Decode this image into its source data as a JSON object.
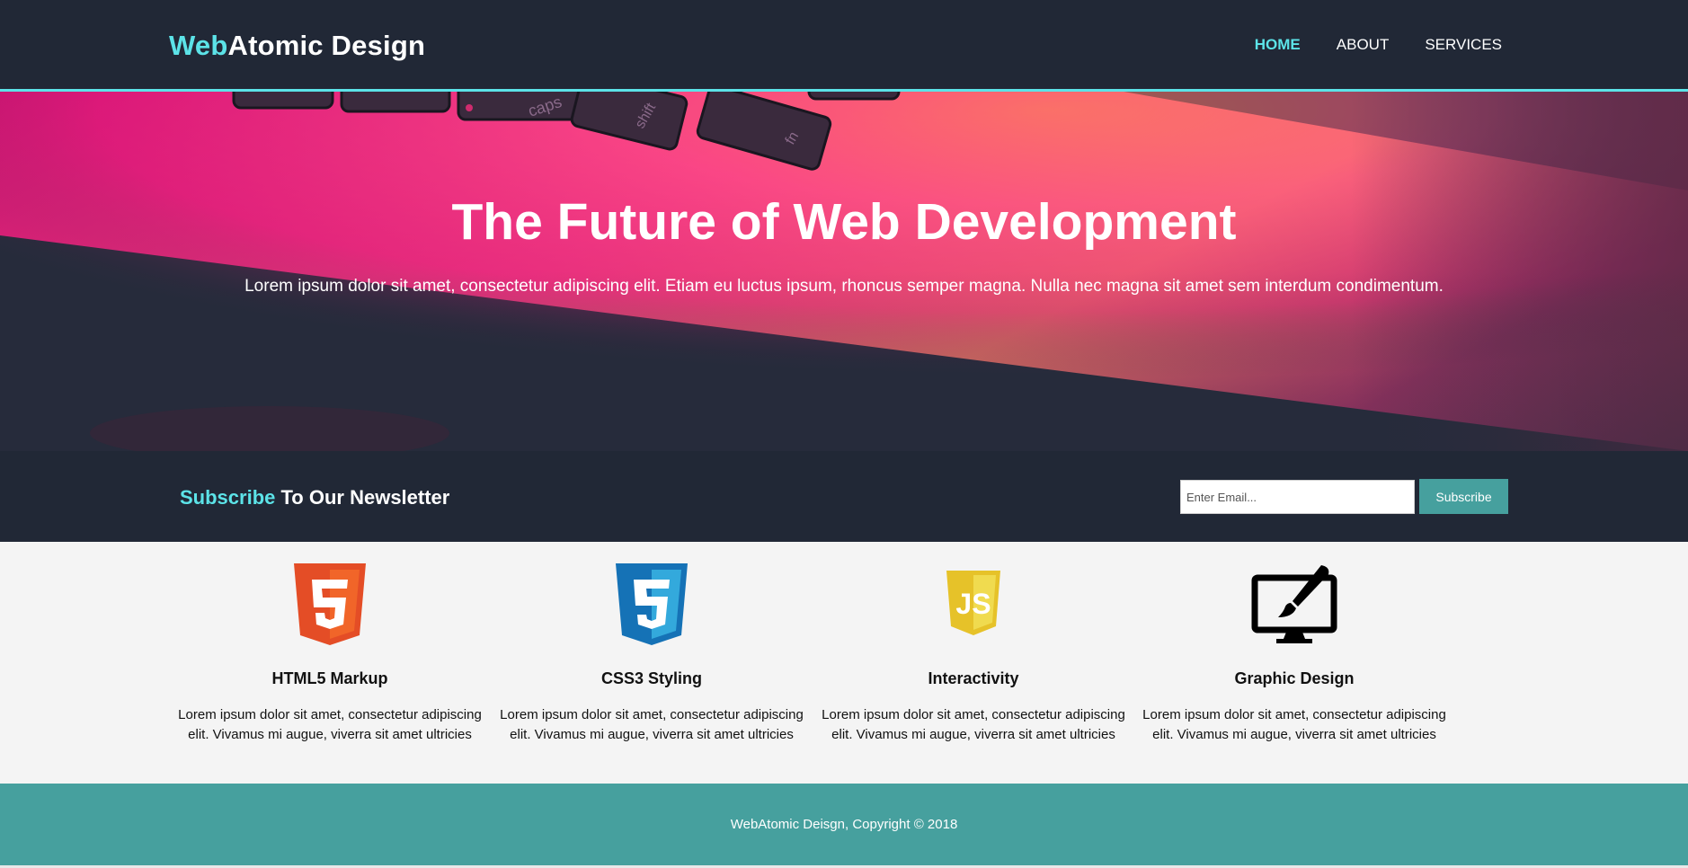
{
  "header": {
    "logo_highlight": "Web",
    "logo_rest": "Atomic Design",
    "nav": [
      {
        "label": "HOME",
        "active": true
      },
      {
        "label": "ABOUT",
        "active": false
      },
      {
        "label": "SERVICES",
        "active": false
      }
    ]
  },
  "hero": {
    "title": "The Future of Web Development",
    "text": "Lorem ipsum dolor sit amet, consectetur adipiscing elit. Etiam eu luctus ipsum, rhoncus semper magna. Nulla nec magna sit amet sem interdum condimentum.",
    "key_labels": [
      "caps",
      "shift",
      "fn"
    ]
  },
  "newsletter": {
    "title_highlight": "Subscribe",
    "title_rest": "To Our Newsletter",
    "email_placeholder": "Enter Email...",
    "button_label": "Subscribe"
  },
  "features": [
    {
      "icon": "html5-icon",
      "title": "HTML5 Markup",
      "text": "Lorem ipsum dolor sit amet, consectetur adipiscing elit. Vivamus mi augue, viverra sit amet ultricies"
    },
    {
      "icon": "css3-icon",
      "title": "CSS3 Styling",
      "text": "Lorem ipsum dolor sit amet, consectetur adipiscing elit. Vivamus mi augue, viverra sit amet ultricies"
    },
    {
      "icon": "javascript-icon",
      "title": "Interactivity",
      "text": "Lorem ipsum dolor sit amet, consectetur adipiscing elit. Vivamus mi augue, viverra sit amet ultricies"
    },
    {
      "icon": "monitor-brush-icon",
      "title": "Graphic Design",
      "text": "Lorem ipsum dolor sit amet, consectetur adipiscing elit. Vivamus mi augue, viverra sit amet ultricies"
    }
  ],
  "footer": {
    "text": "WebAtomic Deisgn, Copyright © 2018"
  },
  "colors": {
    "dark": "#212836",
    "accent": "#5ce3e8",
    "teal": "#46a09e",
    "light_bg": "#f4f4f4",
    "html5": "#e44d26",
    "css3": "#1572b6",
    "javascript": "#f0db4f"
  }
}
